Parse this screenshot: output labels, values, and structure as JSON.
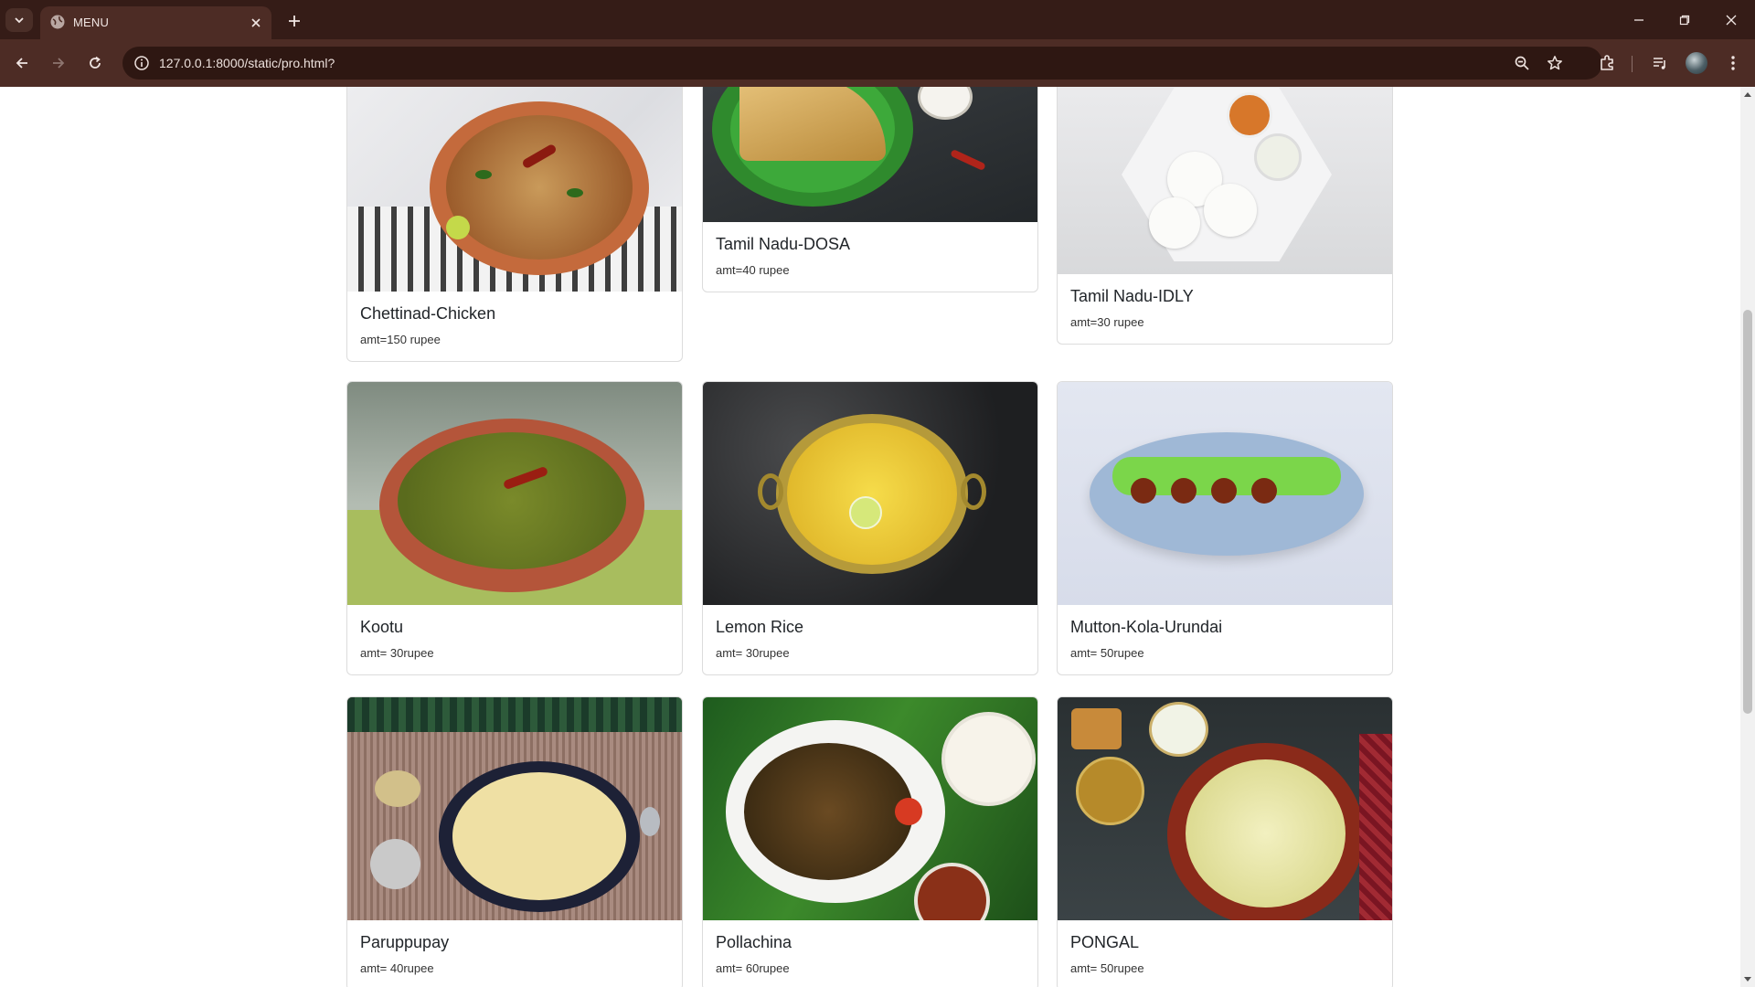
{
  "browser": {
    "tab_title": "MENU",
    "url": "127.0.0.1:8000/static/pro.html?"
  },
  "menu": {
    "items": [
      {
        "name": "Chettinad-Chicken",
        "price": "amt=150 rupee"
      },
      {
        "name": "Tamil Nadu-DOSA",
        "price": "amt=40 rupee"
      },
      {
        "name": "Tamil Nadu-IDLY",
        "price": "amt=30 rupee"
      },
      {
        "name": "Kootu",
        "price": "amt= 30rupee"
      },
      {
        "name": "Lemon Rice",
        "price": "amt= 30rupee"
      },
      {
        "name": "Mutton-Kola-Urundai",
        "price": "amt= 50rupee"
      },
      {
        "name": "Paruppupay",
        "price": "amt= 40rupee"
      },
      {
        "name": "Pollachina",
        "price": "amt= 60rupee"
      },
      {
        "name": "PONGAL",
        "price": "amt= 50rupee"
      }
    ]
  },
  "colors": {
    "chrome_dark": "#351c17",
    "chrome_toolbar": "#4d2c25",
    "card_border": "#dcdcdc"
  }
}
